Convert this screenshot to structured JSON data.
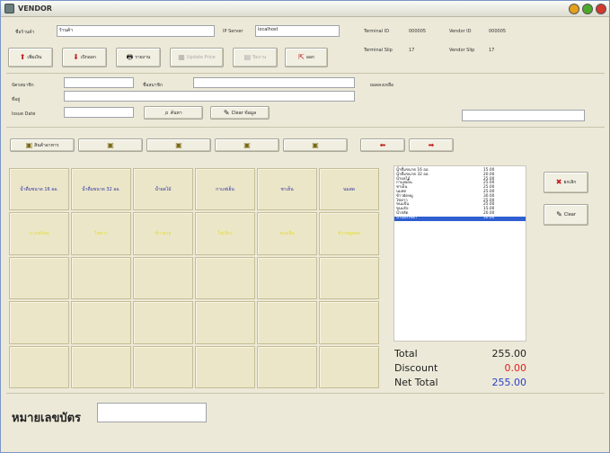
{
  "window": {
    "title": "VENDOR"
  },
  "header": {
    "shop_label": "ชื่อร้านค้า",
    "shop_value": "ร้านค้า",
    "ip_label": "IP Server",
    "ip_value": "localhost",
    "terminal_id_label": "Terminal ID",
    "terminal_id": "000005",
    "vendor_id_label": "Vendor ID",
    "vendor_id": "000005",
    "terminal_slip_label": "Terminal Slip",
    "terminal_slip": "17",
    "vendor_slip_label": "Vendor Slip",
    "vendor_slip": "17"
  },
  "toolbar": [
    "เพิ่มเงิน",
    "เบิกออก",
    "รายงาน",
    "Update Price",
    "ปิดงาน",
    "ออก"
  ],
  "member": {
    "card_label": "บัตรสมาชิก",
    "name_label": "ชื่อสมาชิก",
    "balance_label": "ยอดคงเหลือ",
    "address_label": "ที่อยู่",
    "issue_label": "Issue Date",
    "search_label": "ค้นหา",
    "clear_label": "Clear ข้อมูล"
  },
  "categories": [
    "สินค้าอาหาร",
    "",
    "",
    "",
    "",
    ""
  ],
  "products": {
    "row1": [
      "น้ำดื่มขนาด 16 ออ.",
      "น้ำดื่มขนาด 32 ออ.",
      "น้ำผลไม้",
      "กาแฟเย็น",
      "ชาเย็น",
      "นมสด"
    ],
    "row2": [
      "กาแฟร้อน",
      "ไข่ดาว",
      "ข้าวสวย",
      "ไข่เจียว",
      "ขนมจีน",
      "ข้าวหมูทอด"
    ]
  },
  "items": [
    {
      "name": "น้ำดื่มขนาด 16 ออ.",
      "price": "15.00"
    },
    {
      "name": "น้ำดื่มขนาด 32 ออ.",
      "price": "20.00"
    },
    {
      "name": "น้ำผลไม้",
      "price": "25.00"
    },
    {
      "name": "กาแฟเย็น",
      "price": "25.00"
    },
    {
      "name": "ชาเย็น",
      "price": "25.00"
    },
    {
      "name": "นมสด",
      "price": "25.00"
    },
    {
      "name": "ข้าวผัดหมู",
      "price": "30.00"
    },
    {
      "name": "ไข่ดาว",
      "price": "25.00"
    },
    {
      "name": "ขนมจีน",
      "price": "25.00"
    },
    {
      "name": "ขนมปัง",
      "price": "15.00"
    },
    {
      "name": "น้ำสลัด",
      "price": "20.00"
    },
    {
      "name": "น้ำแดงโซดา",
      "price": "30.00"
    }
  ],
  "actions": {
    "cancel_label": "ยกเลิก",
    "clear_label": "Clear"
  },
  "totals": {
    "total_label": "Total",
    "total": "255.00",
    "discount_label": "Discount",
    "discount": "0.00",
    "net_label": "Net Total",
    "net": "255.00"
  },
  "footer": {
    "card_no_label": "หมายเลขบัตร"
  },
  "colors": {
    "discount": "#e02020",
    "net": "#2a3fc8",
    "selected_row": "#2f5fd0"
  }
}
